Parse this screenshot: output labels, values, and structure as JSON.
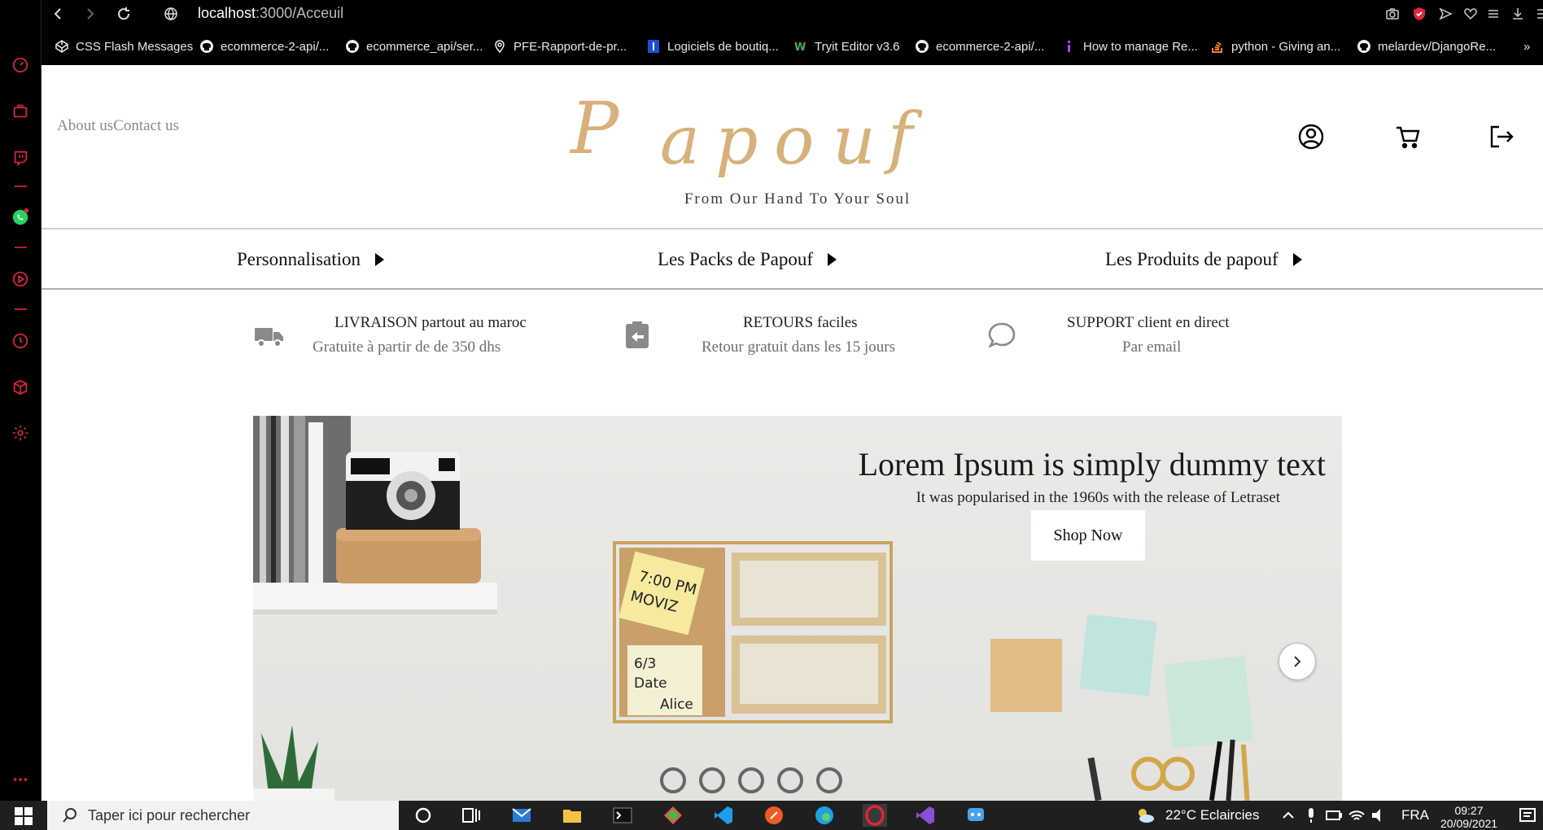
{
  "browser": {
    "url_host": "localhost",
    "url_path": ":3000/Acceuil",
    "bookmarks": [
      {
        "label": "CSS Flash Messages",
        "icon": "codepen-icon"
      },
      {
        "label": "ecommerce-2-api/...",
        "icon": "github-icon"
      },
      {
        "label": "ecommerce_api/ser...",
        "icon": "github-icon"
      },
      {
        "label": "PFE-Rapport-de-pr...",
        "icon": "map-pin-icon"
      },
      {
        "label": "Logiciels de boutiq...",
        "icon": "site-icon"
      },
      {
        "label": "Tryit Editor v3.6",
        "icon": "w3schools-icon"
      },
      {
        "label": "ecommerce-2-api/...",
        "icon": "github-icon"
      },
      {
        "label": "How to manage Re...",
        "icon": "info-icon"
      },
      {
        "label": "python - Giving an...",
        "icon": "stackoverflow-icon"
      },
      {
        "label": "melardev/DjangoRe...",
        "icon": "github-icon"
      }
    ],
    "more_bookmarks": "»"
  },
  "header": {
    "top_links": "About usContact us",
    "logo_letters": [
      "P",
      "a",
      "p",
      "o",
      "u",
      "f"
    ],
    "tagline": "From Our Hand To Your Soul"
  },
  "categories": [
    {
      "label": "Personnalisation"
    },
    {
      "label": "Les Packs de Papouf"
    },
    {
      "label": "Les Produits de papouf"
    }
  ],
  "features": [
    {
      "title": "LIVRAISON partout au maroc",
      "subtitle": "Gratuite à partir de de 350 dhs",
      "icon": "truck-icon"
    },
    {
      "title": "RETOURS faciles",
      "subtitle": "Retour gratuit dans les 15 jours",
      "icon": "return-icon"
    },
    {
      "title": "SUPPORT client en direct",
      "subtitle": "Par email",
      "icon": "chat-bubble-icon"
    }
  ],
  "banner": {
    "title": "Lorem Ipsum is simply dummy text",
    "subtitle": "It was popularised in the 1960s with the release of Letraset",
    "button": "Shop Now",
    "note_1_line1": "7:00 PM",
    "note_1_line2": "MOVIZ",
    "note_2_line1": "6/3",
    "note_2_line2": "Date",
    "note_2_line3": "Alice"
  },
  "taskbar": {
    "search_placeholder": "Taper ici pour rechercher",
    "weather": "22°C  Eclaircies",
    "language": "FRA",
    "time": "09:27",
    "date": "20/09/2021"
  },
  "colors": {
    "logo": "#d8b07b",
    "opera_red": "#c0192f",
    "sidebar_bg": "#000000"
  }
}
